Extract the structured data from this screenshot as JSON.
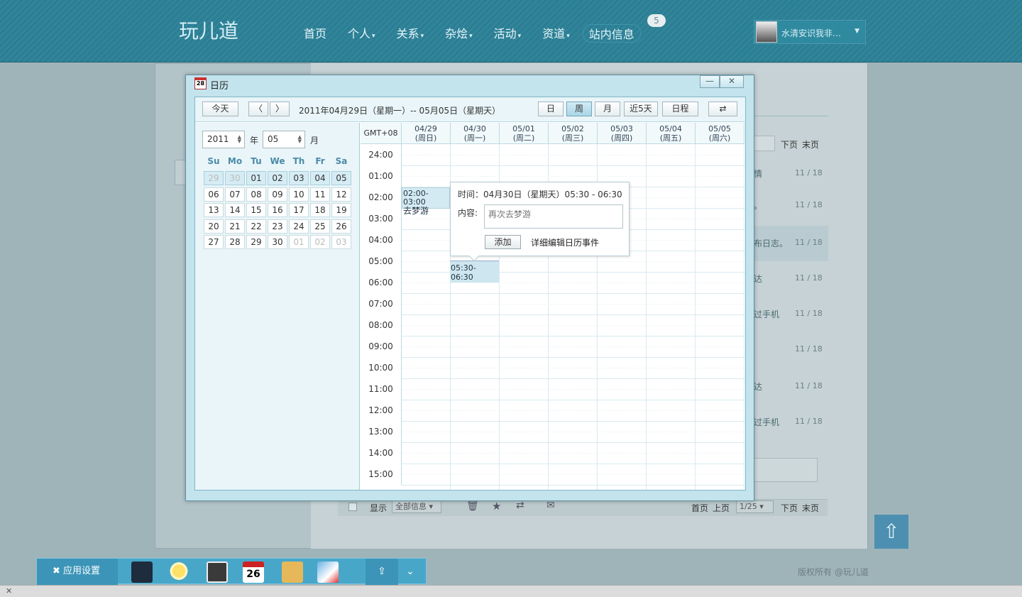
{
  "header": {
    "logo": "玩儿道",
    "nav": [
      "首页",
      "个人",
      "关系",
      "杂烩",
      "活动",
      "资道",
      "站内信息"
    ],
    "nav_has_caret": [
      false,
      true,
      true,
      true,
      true,
      true,
      false
    ],
    "message_badge": "5",
    "user_name": "水清安识我非…"
  },
  "background_page": {
    "list_rows": [
      {
        "text": "情",
        "date": "11 / 18"
      },
      {
        "text": "。",
        "date": "11 / 18"
      },
      {
        "text": "布日志。",
        "date": "11 / 18"
      },
      {
        "text": "达",
        "date": "11 / 18"
      },
      {
        "text": "过手机",
        "date": "11 / 18"
      },
      {
        "text": "",
        "date": "11 / 18"
      },
      {
        "text": "达",
        "date": "11 / 18"
      },
      {
        "text": "过手机",
        "date": "11 / 18"
      }
    ],
    "pager_top": {
      "next": "下页",
      "last": "末页"
    },
    "bottom_bar": {
      "show_label": "显示",
      "filter_value": "全部信息",
      "first": "首页",
      "prev": "上页",
      "page": "1/25",
      "next": "下页",
      "last": "末页"
    },
    "footer": "版权所有 @玩儿道"
  },
  "dock": {
    "settings_label": "应用设置",
    "calendar_day": "26",
    "up_icon": "upload-icon",
    "expand_icon": "chevron-double-down-icon"
  },
  "calendar_dialog": {
    "title": "日历",
    "window_buttons": [
      "minimize",
      "close"
    ],
    "toolbar": {
      "today": "今天",
      "range": "2011年04月29日（星期一）-- 05月05日（星期天）",
      "views": [
        "日",
        "周",
        "月",
        "近5天",
        "日程"
      ],
      "active_view": "周"
    },
    "mini_calendar": {
      "year": "2011",
      "year_unit": "年",
      "month": "05",
      "month_unit": "月",
      "weekdays": [
        "Su",
        "Mo",
        "Tu",
        "We",
        "Th",
        "Fr",
        "Sa"
      ],
      "weeks": [
        [
          "29",
          "30",
          "01",
          "02",
          "03",
          "04",
          "05"
        ],
        [
          "06",
          "07",
          "08",
          "09",
          "10",
          "11",
          "12"
        ],
        [
          "13",
          "14",
          "15",
          "16",
          "17",
          "18",
          "19"
        ],
        [
          "20",
          "21",
          "22",
          "23",
          "24",
          "25",
          "26"
        ],
        [
          "27",
          "28",
          "29",
          "30",
          "01",
          "02",
          "03"
        ]
      ]
    },
    "week_grid": {
      "timezone": "GMT+08",
      "columns": [
        {
          "date": "04/29",
          "weekday": "(周日)"
        },
        {
          "date": "04/30",
          "weekday": "(周一)"
        },
        {
          "date": "05/01",
          "weekday": "(周二)"
        },
        {
          "date": "05/02",
          "weekday": "(周三)"
        },
        {
          "date": "05/03",
          "weekday": "(周四)"
        },
        {
          "date": "05/04",
          "weekday": "(周五)"
        },
        {
          "date": "05/05",
          "weekday": "(周六)"
        }
      ],
      "hours": [
        "24:00",
        "01:00",
        "02:00",
        "03:00",
        "04:00",
        "05:00",
        "06:00",
        "07:00",
        "08:00",
        "09:00",
        "10:00",
        "11:00",
        "12:00",
        "13:00",
        "14:00",
        "15:00"
      ],
      "events": [
        {
          "time": "02:00-03:00",
          "title": "去梦游"
        },
        {
          "time": "05:30-06:30",
          "title": ""
        }
      ]
    },
    "popup": {
      "time_label": "时间：",
      "time_value": "04月30日（星期天）05:30 - 06:30",
      "content_label": "内容:",
      "content_placeholder": "再次去梦游",
      "add_button": "添加",
      "detail_link": "详细编辑日历事件"
    }
  }
}
